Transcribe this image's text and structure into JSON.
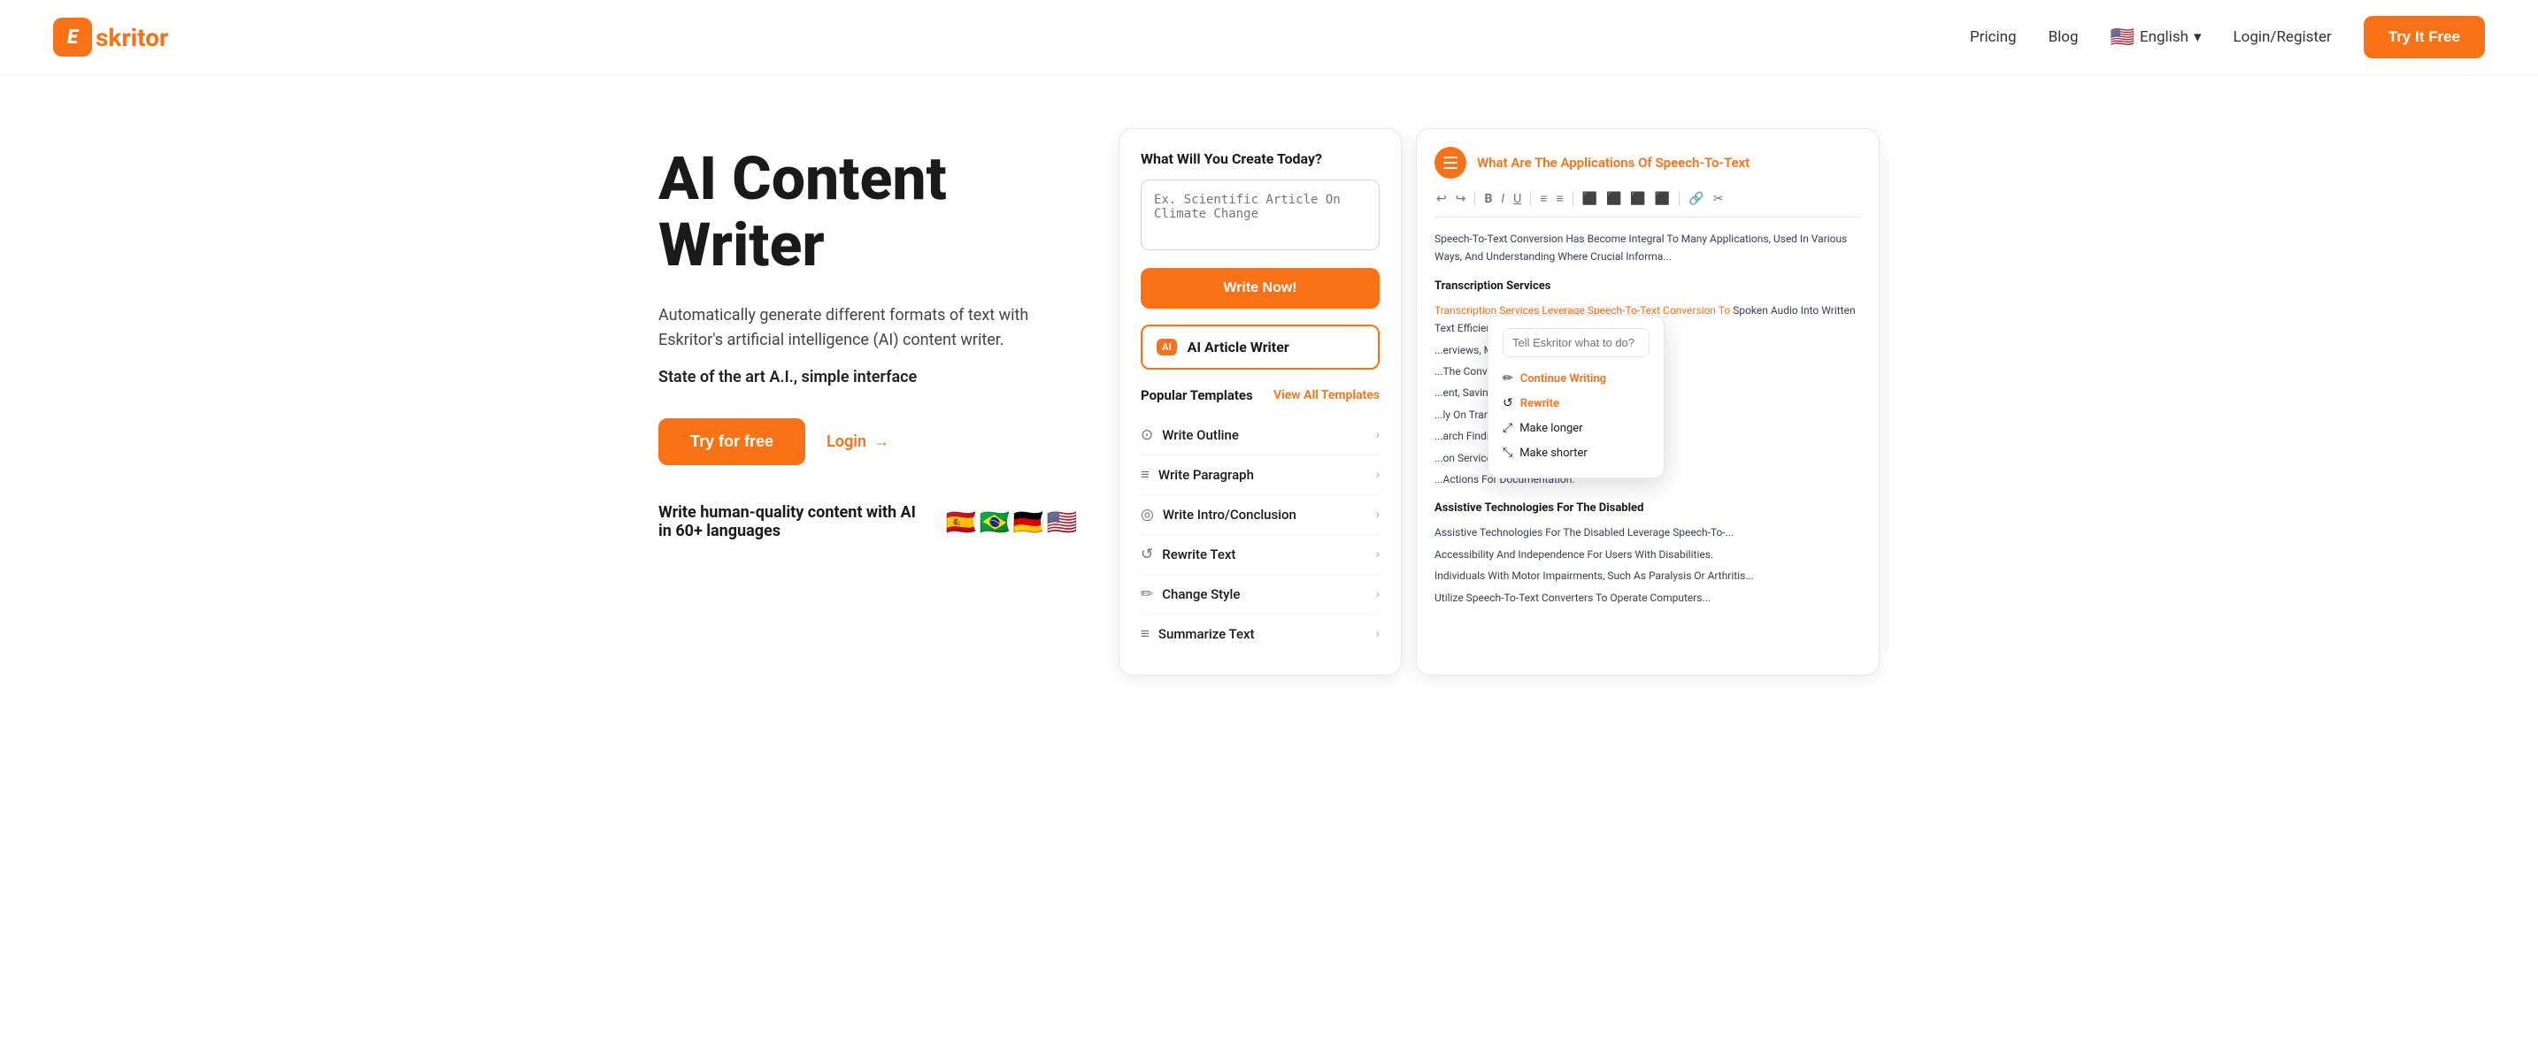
{
  "brand": {
    "letter": "E",
    "name": "skritor"
  },
  "nav": {
    "links": [
      {
        "id": "pricing",
        "label": "Pricing"
      },
      {
        "id": "blog",
        "label": "Blog"
      }
    ],
    "language": {
      "flag": "🇺🇸",
      "label": "English",
      "chevron": "▾"
    },
    "login": "Login/Register",
    "cta": "Try It Free"
  },
  "hero": {
    "title": "AI Content Writer",
    "subtitle1": "Automatically generate different formats of text with Eskritor's artificial intelligence (AI) content writer.",
    "subtitle2": "State of the art A.I., simple interface",
    "try_label": "Try for free",
    "login_label": "Login",
    "arrow": "→",
    "languages_text": "Write human-quality content with AI in 60+ languages",
    "flags": [
      "🇪🇸",
      "🇧🇷",
      "🇩🇪",
      "🇺🇸"
    ]
  },
  "left_panel": {
    "title": "What Will You Create Today?",
    "input_placeholder": "Ex. Scientific Article On Climate Change",
    "write_btn": "Write Now!",
    "ai_badge": "AI",
    "ai_label": "AI Article Writer",
    "popular_title": "Popular Templates",
    "view_all": "View All Templates",
    "templates": [
      {
        "id": "outline",
        "icon": "⊙",
        "label": "Write Outline"
      },
      {
        "id": "paragraph",
        "icon": "≡",
        "label": "Write Paragraph"
      },
      {
        "id": "intro",
        "icon": "◎",
        "label": "Write Intro/Conclusion"
      },
      {
        "id": "rewrite",
        "icon": "↺",
        "label": "Rewrite Text"
      },
      {
        "id": "style",
        "icon": "✏",
        "label": "Change Style"
      },
      {
        "id": "summarize",
        "icon": "≡",
        "label": "Summarize Text"
      }
    ]
  },
  "right_panel": {
    "title_plain": "What Are The Applications ",
    "title_highlight": "Of Speech-To-Text",
    "toolbar_icons": [
      "↩",
      "↪",
      "B",
      "I",
      "U",
      "≡",
      "≡",
      "≡",
      "≡",
      "⊞",
      "⊟"
    ],
    "body_intro": "Speech-To-Text Conversion Has Become Integral To Many Applications, Used In Various Ways, And Understanding Where Crucial Informa...",
    "section1_title": "Transcription Services",
    "section1_highlight": "Transcription Services Leverage Speech-To-Text Conversion To",
    "section1_cont": "Spoken Audio Into Written Text Efficiently. Editors Benefit Transcrip...",
    "section2_text1": "...erviews, Meetings, Lectures, And Other...",
    "section2_text2": "...The Convenience Of Quickly And Accurately...",
    "section2_text3": "...ent, Saving Time And Effort. Writing Wri...",
    "section2_text4": "...ly On Transcription Services To Locate...",
    "section2_text5": "...arch Findings.",
    "section2_text6": "...on Services To Generate Written Thes...",
    "section2_text7": "...Actions For Documentation.",
    "section3_title": "Assistive Technologies For The Disabled",
    "section3_text1": "Assistive Technologies For The Disabled Leverage Speech-To-...",
    "section3_text2": "Accessibility And Independence For Users With Disabilities.",
    "section3_text3": "Individuals With Motor Impairments, Such As Paralysis Or Arthritis...",
    "section3_text4": "Utilize Speech-To-Text Converters To Operate Computers..."
  },
  "tooltip": {
    "placeholder": "Tell Eskritor what to do?",
    "options": [
      {
        "id": "continue",
        "icon": "✏",
        "label": "Continue Writing"
      },
      {
        "id": "rewrite",
        "icon": "↺",
        "label": "Rewrite"
      },
      {
        "id": "longer",
        "icon": "⤢",
        "label": "Make longer"
      },
      {
        "id": "shorter",
        "icon": "⤡",
        "label": "Make shorter"
      }
    ]
  }
}
